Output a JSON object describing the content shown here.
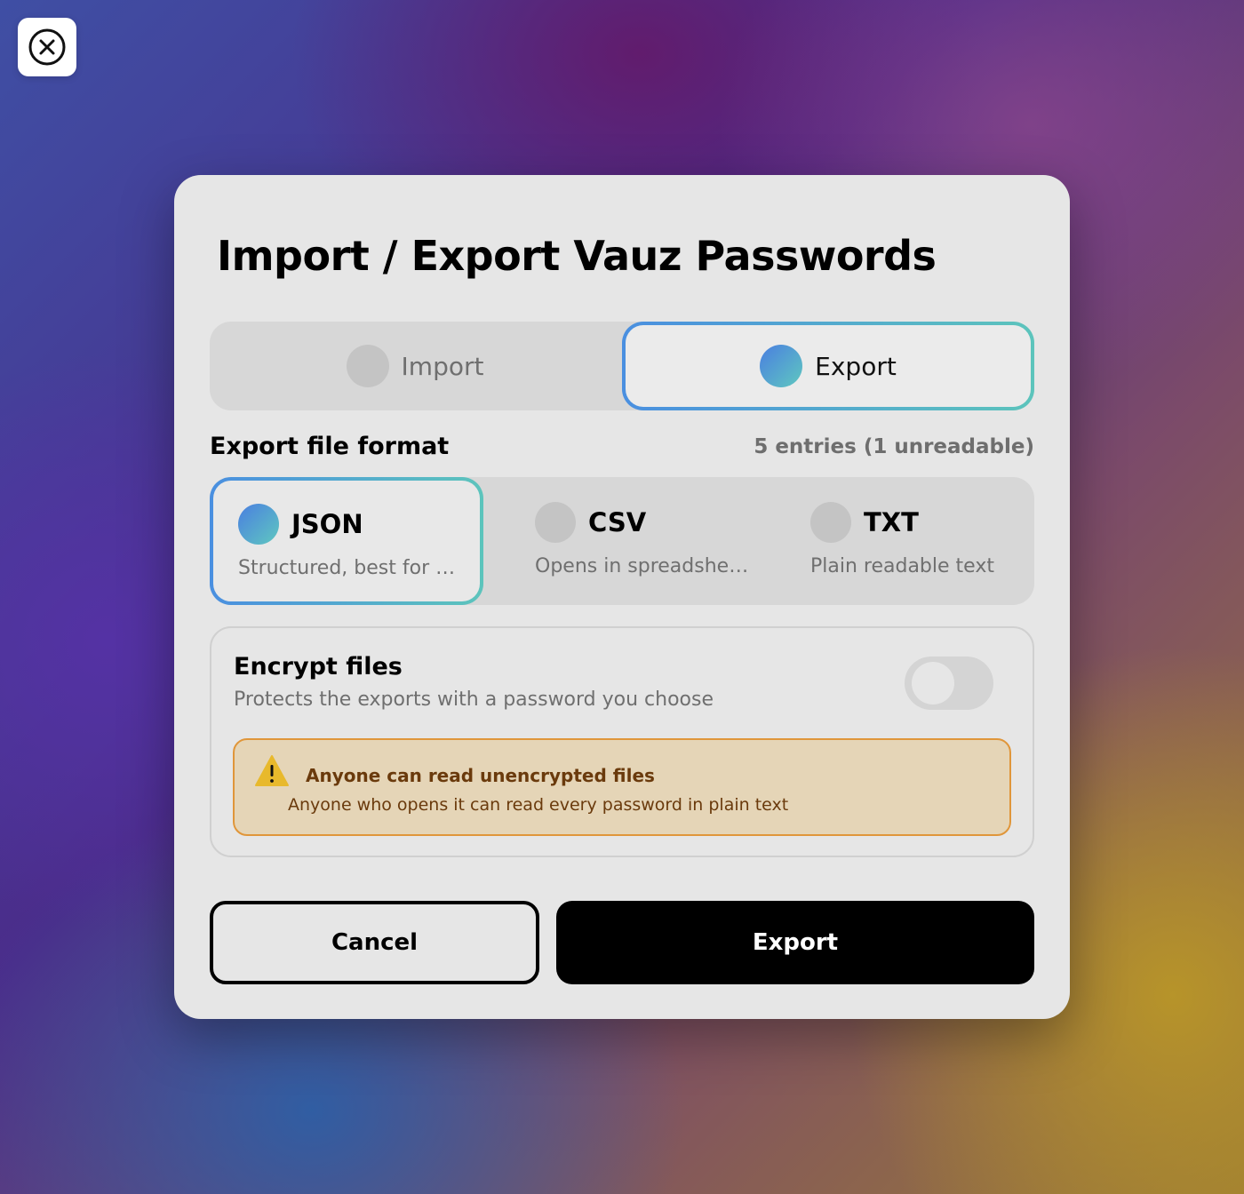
{
  "dialog": {
    "title": "Import / Export Vauz Passwords"
  },
  "mode": {
    "options": [
      {
        "label": "Import",
        "selected": false
      },
      {
        "label": "Export",
        "selected": true
      }
    ]
  },
  "format": {
    "section_label": "Export file format",
    "entries_count": "5 entries (1 unreadable)",
    "options": [
      {
        "name": "JSON",
        "description": "Structured, best for import",
        "selected": true
      },
      {
        "name": "CSV",
        "description": "Opens in spreadsheets",
        "selected": false
      },
      {
        "name": "TXT",
        "description": "Plain readable text",
        "selected": false
      }
    ]
  },
  "encrypt": {
    "title": "Encrypt files",
    "description": "Protects the exports with a password you choose",
    "enabled": false,
    "warning": {
      "title": "Anyone can read unencrypted files",
      "text": "Anyone who opens it can read every password in plain text"
    }
  },
  "actions": {
    "cancel_label": "Cancel",
    "export_label": "Export"
  },
  "icons": {
    "close": "close-icon",
    "warning": "warning-icon"
  },
  "colors": {
    "accent_start": "#4a7ee0",
    "accent_end": "#5fc8c0",
    "warning_bg": "#e5d5b7",
    "warning_border": "#e0963a",
    "warning_text": "#6a3a0c"
  }
}
